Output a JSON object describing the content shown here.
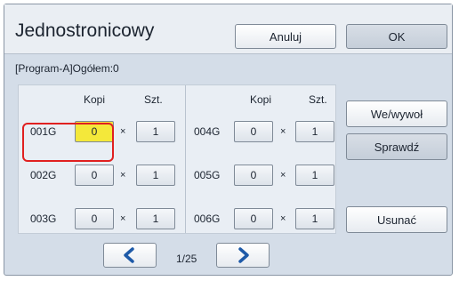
{
  "header": {
    "title": "Jednostronicowy",
    "cancel_label": "Anuluj",
    "ok_label": "OK"
  },
  "status": "[Program-A]Ogółem:0",
  "columns": {
    "kopi": "Kopi",
    "szt": "Szt.",
    "times": "×"
  },
  "rows_left": [
    {
      "label": "001G",
      "kopi": "0",
      "szt": "1"
    },
    {
      "label": "002G",
      "kopi": "0",
      "szt": "1"
    },
    {
      "label": "003G",
      "kopi": "0",
      "szt": "1"
    }
  ],
  "rows_right": [
    {
      "label": "004G",
      "kopi": "0",
      "szt": "1"
    },
    {
      "label": "005G",
      "kopi": "0",
      "szt": "1"
    },
    {
      "label": "006G",
      "kopi": "0",
      "szt": "1"
    }
  ],
  "side": {
    "import_export_label": "We/wywoł",
    "check_label": "Sprawdź",
    "delete_label": "Usunać"
  },
  "pager": {
    "page": "1/25"
  },
  "colors": {
    "accent_highlight": "#e02020",
    "active_field": "#f4e83a",
    "panel_bg": "#d4dde8"
  },
  "icons": {
    "prev": "chevron-left-icon",
    "next": "chevron-right-icon"
  }
}
